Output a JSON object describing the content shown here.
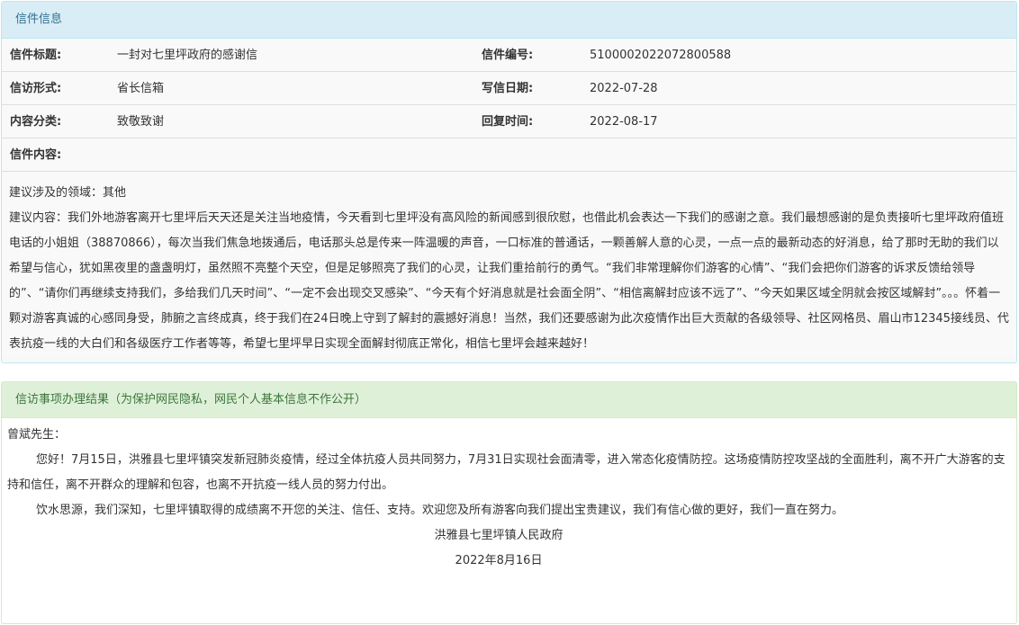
{
  "letter_info": {
    "heading": "信件信息",
    "rows": [
      {
        "label1": "信件标题:",
        "value1": "一封对七里坪政府的感谢信",
        "label2": "信件编号:",
        "value2": "5100002022072800588"
      },
      {
        "label1": "信访形式:",
        "value1": "省长信箱",
        "label2": "写信日期:",
        "value2": "2022-07-28"
      },
      {
        "label1": "内容分类:",
        "value1": "致敬致谢",
        "label2": "回复时间:",
        "value2": "2022-08-17"
      }
    ],
    "content_label": "信件内容:",
    "domain_line": "建议涉及的领域：其他",
    "content_text": "建议内容：我们外地游客离开七里坪后天天还是关注当地疫情，今天看到七里坪没有高风险的新闻感到很欣慰，也借此机会表达一下我们的感谢之意。我们最想感谢的是负责接听七里坪政府值班电话的小姐姐（38870866），每次当我们焦急地拨通后，电话那头总是传来一阵温暖的声音，一口标准的普通话，一颗善解人意的心灵，一点一点的最新动态的好消息，给了那时无助的我们以希望与信心，犹如黑夜里的盏盏明灯，虽然照不亮整个天空，但是足够照亮了我们的心灵，让我们重拾前行的勇气。“我们非常理解你们游客的心情”、“我们会把你们游客的诉求反馈给领导的”、“请你们再继续支持我们，多给我们几天时间”、“一定不会出现交叉感染”、“今天有个好消息就是社会面全阴”、“相信离解封应该不远了”、“今天如果区域全阴就会按区域解封”。。。怀着一颗对游客真诚的心感同身受，肺腑之言终成真，终于我们在24日晚上守到了解封的震撼好消息！当然，我们还要感谢为此次疫情作出巨大贡献的各级领导、社区网格员、眉山市12345接线员、代表抗疫一线的大白们和各级医疗工作者等等，希望七里坪早日实现全面解封彻底正常化，相信七里坪会越来越好！"
  },
  "reply": {
    "heading": "信访事项办理结果（为保护网民隐私，网民个人基本信息不作公开）",
    "salutation": "曾斌先生：",
    "para1": "您好！7月15日，洪雅县七里坪镇突发新冠肺炎疫情，经过全体抗疫人员共同努力，7月31日实现社会面清零，进入常态化疫情防控。这场疫情防控攻坚战的全面胜利，离不开广大游客的支持和信任，离不开群众的理解和包容，也离不开抗疫一线人员的努力付出。",
    "para2": "饮水思源，我们深知，七里坪镇取得的成绩离不开您的关注、信任、支持。欢迎您及所有游客向我们提出宝贵建议，我们有信心做的更好，我们一直在努力。",
    "signature_org": "洪雅县七里坪镇人民政府",
    "signature_date": "2022年8月16日"
  }
}
